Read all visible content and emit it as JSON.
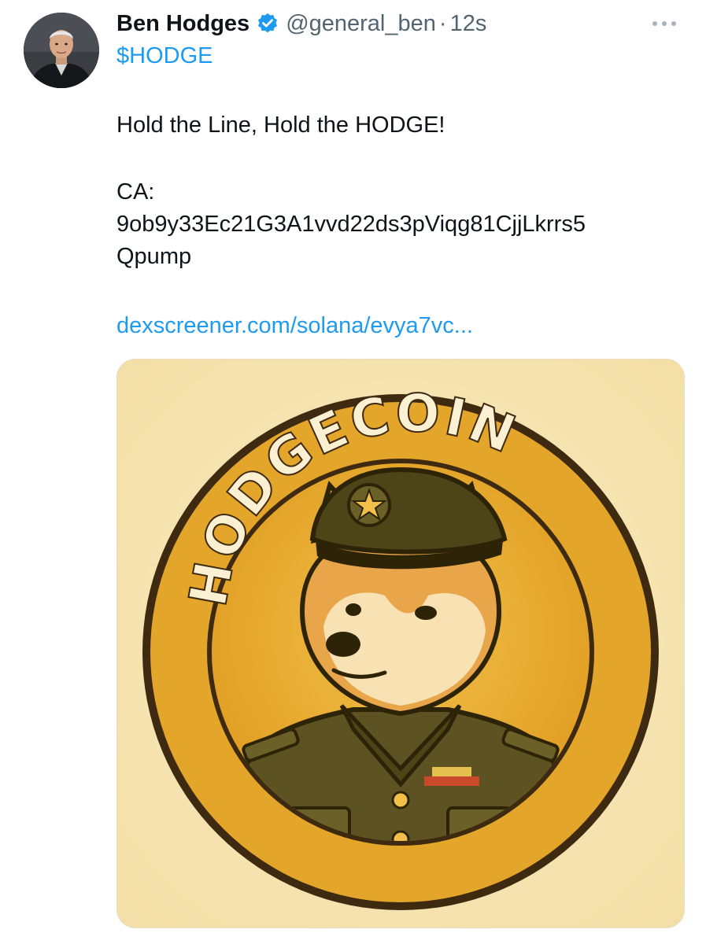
{
  "tweet": {
    "author": {
      "display_name": "Ben Hodges",
      "handle": "@general_ben",
      "verified": true
    },
    "separator": "·",
    "timestamp": "12s",
    "cashtag": "$HODGE",
    "body_line1": "Hold the Line, Hold the HODGE!",
    "ca_label": "CA:",
    "ca_line1": "9ob9y33Ec21G3A1vvd22ds3pViqg81CjjLkrrs5",
    "ca_line2": "Qpump",
    "link": "dexscreener.com/solana/evya7vc...",
    "media": {
      "coin_text": "HODGECOIN"
    }
  },
  "colors": {
    "link_blue": "#1d9bf0",
    "text_primary": "#0f1419",
    "text_secondary": "#536471",
    "coin_gold": "#e4a62a",
    "coin_dark": "#3e2a10",
    "uniform_olive": "#5d5222"
  },
  "icons": {
    "verified": "verified-badge-icon",
    "more": "more-dots-icon"
  }
}
